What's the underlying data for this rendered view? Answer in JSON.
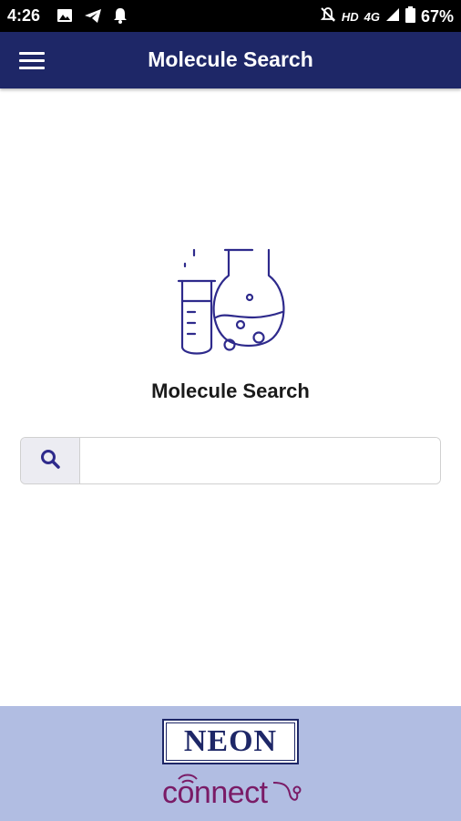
{
  "status_bar": {
    "time": "4:26",
    "network_label": "HD",
    "signal_label": "4G",
    "battery_percent": "67%",
    "icons": [
      "image-icon",
      "telegram-icon",
      "notification-bell-icon",
      "silent-icon",
      "signal-icon",
      "battery-icon"
    ]
  },
  "app_bar": {
    "title": "Molecule Search",
    "menu_icon": "hamburger-menu-icon",
    "background_color": "#1e2767"
  },
  "main": {
    "hero_icon": "lab-flask-icon",
    "heading": "Molecule Search",
    "search": {
      "icon": "search-icon",
      "value": "",
      "placeholder": ""
    }
  },
  "footer": {
    "brand_logo_text": "NEON",
    "brand_sub_text": "connect",
    "background_color": "#b1bde2"
  }
}
